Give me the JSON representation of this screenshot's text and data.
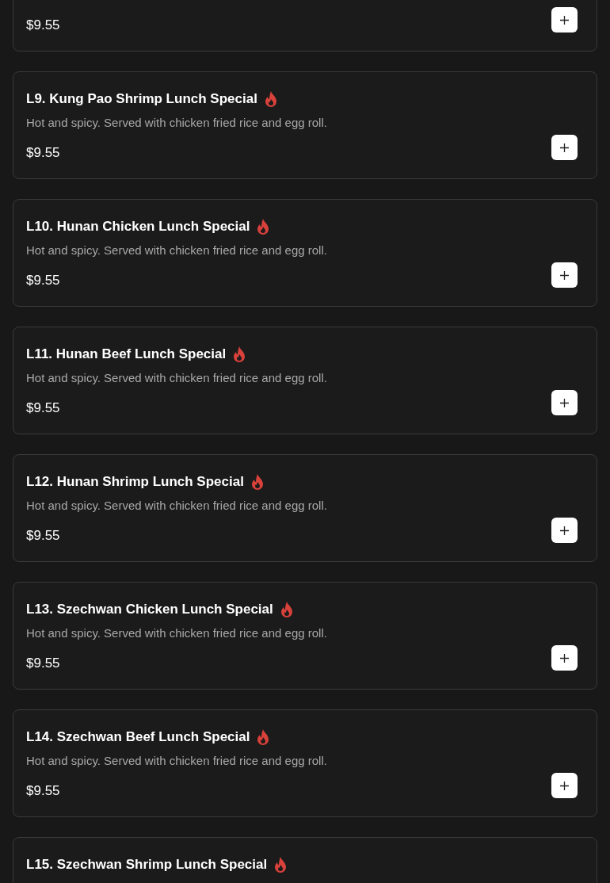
{
  "items": [
    {
      "price": "$9.55"
    },
    {
      "name": "L9. Kung Pao Shrimp Lunch Special",
      "spicy": true,
      "description": "Hot and spicy. Served with chicken fried rice and egg roll.",
      "price": "$9.55"
    },
    {
      "name": "L10. Hunan Chicken Lunch Special",
      "spicy": true,
      "description": "Hot and spicy. Served with chicken fried rice and egg roll.",
      "price": "$9.55"
    },
    {
      "name": "L11. Hunan Beef Lunch Special",
      "spicy": true,
      "description": "Hot and spicy. Served with chicken fried rice and egg roll.",
      "price": "$9.55"
    },
    {
      "name": "L12. Hunan Shrimp Lunch Special",
      "spicy": true,
      "description": "Hot and spicy. Served with chicken fried rice and egg roll.",
      "price": "$9.55"
    },
    {
      "name": "L13. Szechwan Chicken Lunch Special",
      "spicy": true,
      "description": "Hot and spicy. Served with chicken fried rice and egg roll.",
      "price": "$9.55"
    },
    {
      "name": "L14. Szechwan Beef Lunch Special",
      "spicy": true,
      "description": "Hot and spicy. Served with chicken fried rice and egg roll.",
      "price": "$9.55"
    },
    {
      "name": "L15. Szechwan Shrimp Lunch Special",
      "spicy": true
    }
  ]
}
